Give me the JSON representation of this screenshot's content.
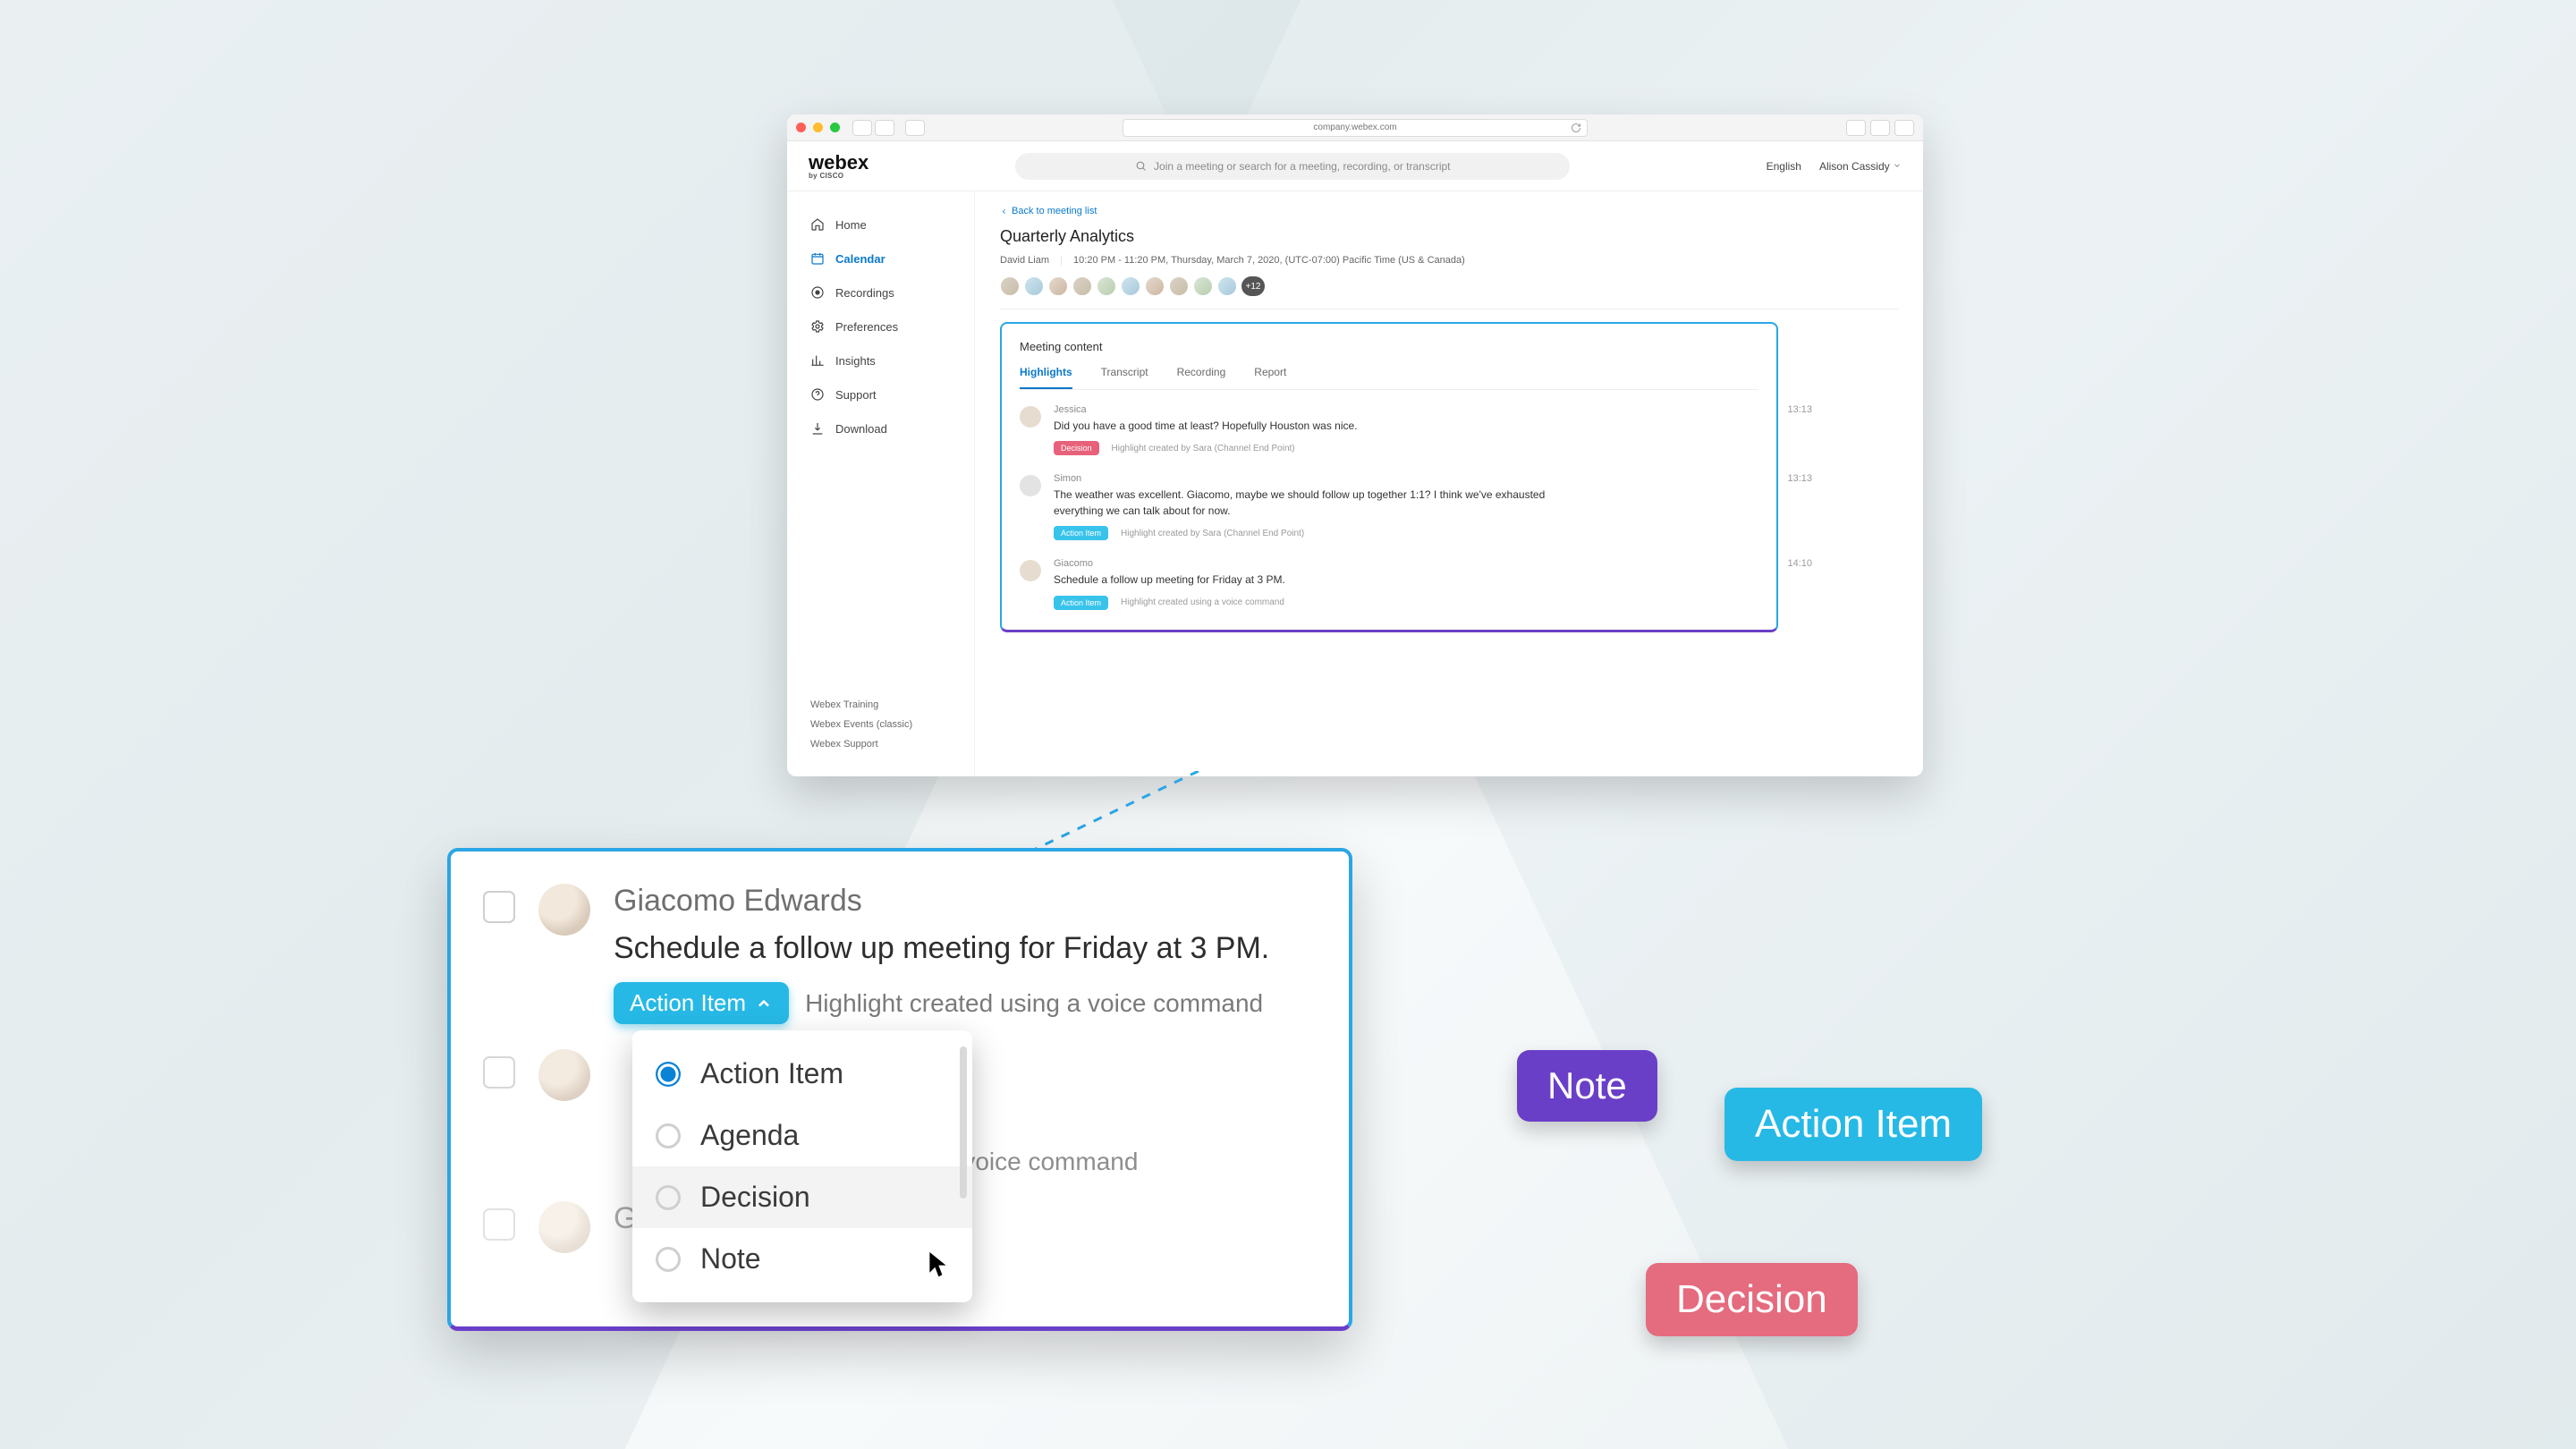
{
  "browser": {
    "url": "company.webex.com"
  },
  "brand": {
    "name": "webex",
    "byline": "by CISCO"
  },
  "search": {
    "placeholder": "Join a meeting or search for a meeting, recording, or transcript"
  },
  "header": {
    "language": "English",
    "user": "Alison Cassidy"
  },
  "sidebar": {
    "items": [
      {
        "icon": "home-icon",
        "label": "Home"
      },
      {
        "icon": "calendar-icon",
        "label": "Calendar",
        "active": true
      },
      {
        "icon": "recordings-icon",
        "label": "Recordings"
      },
      {
        "icon": "preferences-icon",
        "label": "Preferences"
      },
      {
        "icon": "insights-icon",
        "label": "Insights"
      },
      {
        "icon": "support-icon",
        "label": "Support"
      },
      {
        "icon": "download-icon",
        "label": "Download"
      }
    ],
    "footer": [
      "Webex Training",
      "Webex Events (classic)",
      "Webex Support"
    ]
  },
  "meeting": {
    "back": "Back to meeting list",
    "title": "Quarterly Analytics",
    "host": "David Liam",
    "time": "10:20 PM - 11:20 PM, Thursday, March 7, 2020, (UTC-07:00) Pacific Time (US & Canada)",
    "attendee_overflow": "+12"
  },
  "content": {
    "heading": "Meeting content",
    "tabs": [
      "Highlights",
      "Transcript",
      "Recording",
      "Report"
    ],
    "active_tab": "Highlights",
    "highlights": [
      {
        "name": "Jessica",
        "text": "Did you have a good time at least? Hopefully Houston was nice.",
        "badge": "Decision",
        "badge_kind": "dec",
        "meta": "Highlight created by Sara (Channel End Point)",
        "time": "13:13"
      },
      {
        "name": "Simon",
        "text": "The weather was excellent. Giacomo, maybe we should follow up together 1:1? I think we've exhausted everything we can talk about for now.",
        "badge": "Action Item",
        "badge_kind": "act",
        "meta": "Highlight created by Sara (Channel End Point)",
        "time": "13:13"
      },
      {
        "name": "Giacomo",
        "text": "Schedule a follow up meeting for Friday at 3 PM.",
        "badge": "Action Item",
        "badge_kind": "act",
        "meta": "Highlight created using a voice command",
        "time": "14:10"
      }
    ]
  },
  "callout": {
    "rows": [
      {
        "name": "Giacomo Edwards",
        "msg": "Schedule a follow up meeting for Friday at 3 PM.",
        "badge": "Action Item",
        "meta": "Highlight created using a voice command"
      },
      {
        "name": "",
        "msg": "",
        "badge": "",
        "meta": "ated using a voice command"
      },
      {
        "name": "Giacomo Edwards"
      }
    ],
    "dropdown": {
      "selected": "Action Item",
      "options": [
        "Action Item",
        "Agenda",
        "Decision",
        "Note"
      ],
      "hover": "Decision"
    }
  },
  "pills": {
    "note": "Note",
    "action": "Action Item",
    "decision": "Decision"
  }
}
